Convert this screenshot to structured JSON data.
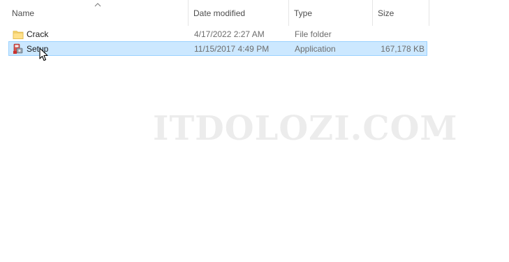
{
  "columns": {
    "name": "Name",
    "date_modified": "Date modified",
    "type": "Type",
    "size": "Size",
    "sort_icon": "sort-ascending-icon"
  },
  "files": [
    {
      "name": "Crack",
      "date_modified": "4/17/2022 2:27 AM",
      "type": "File folder",
      "size": "",
      "icon": "folder-icon",
      "selected": false
    },
    {
      "name": "Setup",
      "date_modified": "11/15/2017 4:49 PM",
      "type": "Application",
      "size": "167,178 KB",
      "icon": "setup-application-icon",
      "selected": true
    }
  ],
  "watermark": "ITDOLOZI.COM",
  "colors": {
    "selection_bg": "#cce8ff",
    "selection_border": "#99d1ff",
    "folder_yellow": "#f8d775"
  }
}
